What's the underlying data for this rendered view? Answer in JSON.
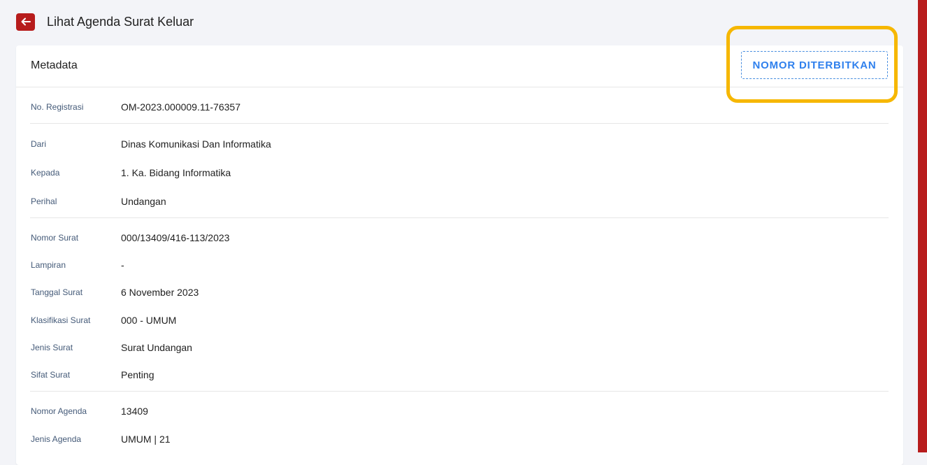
{
  "header": {
    "title": "Lihat Agenda Surat Keluar",
    "back_icon": "arrow-left-icon"
  },
  "card": {
    "title": "Metadata",
    "status_button_label": "NOMOR DITERBITKAN"
  },
  "fields": {
    "no_registrasi": {
      "label": "No. Registrasi",
      "value": "OM-2023.000009.11-76357"
    },
    "dari": {
      "label": "Dari",
      "value": "Dinas Komunikasi Dan Informatika"
    },
    "kepada": {
      "label": "Kepada",
      "value": "1. Ka. Bidang Informatika"
    },
    "perihal": {
      "label": "Perihal",
      "value": "Undangan"
    },
    "nomor_surat": {
      "label": "Nomor Surat",
      "value": "000/13409/416-113/2023"
    },
    "lampiran": {
      "label": "Lampiran",
      "value": "-"
    },
    "tanggal_surat": {
      "label": "Tanggal Surat",
      "value": "6 November 2023"
    },
    "klasifikasi_surat": {
      "label": "Klasifikasi Surat",
      "value": "000 - UMUM"
    },
    "jenis_surat": {
      "label": "Jenis Surat",
      "value": "Surat Undangan"
    },
    "sifat_surat": {
      "label": "Sifat Surat",
      "value": "Penting"
    },
    "nomor_agenda": {
      "label": "Nomor Agenda",
      "value": "13409"
    },
    "jenis_agenda": {
      "label": "Jenis Agenda",
      "value": "UMUM | 21"
    }
  },
  "colors": {
    "accent": "#b71c1c",
    "highlight": "#f6b700",
    "link_blue": "#2f80ed"
  }
}
